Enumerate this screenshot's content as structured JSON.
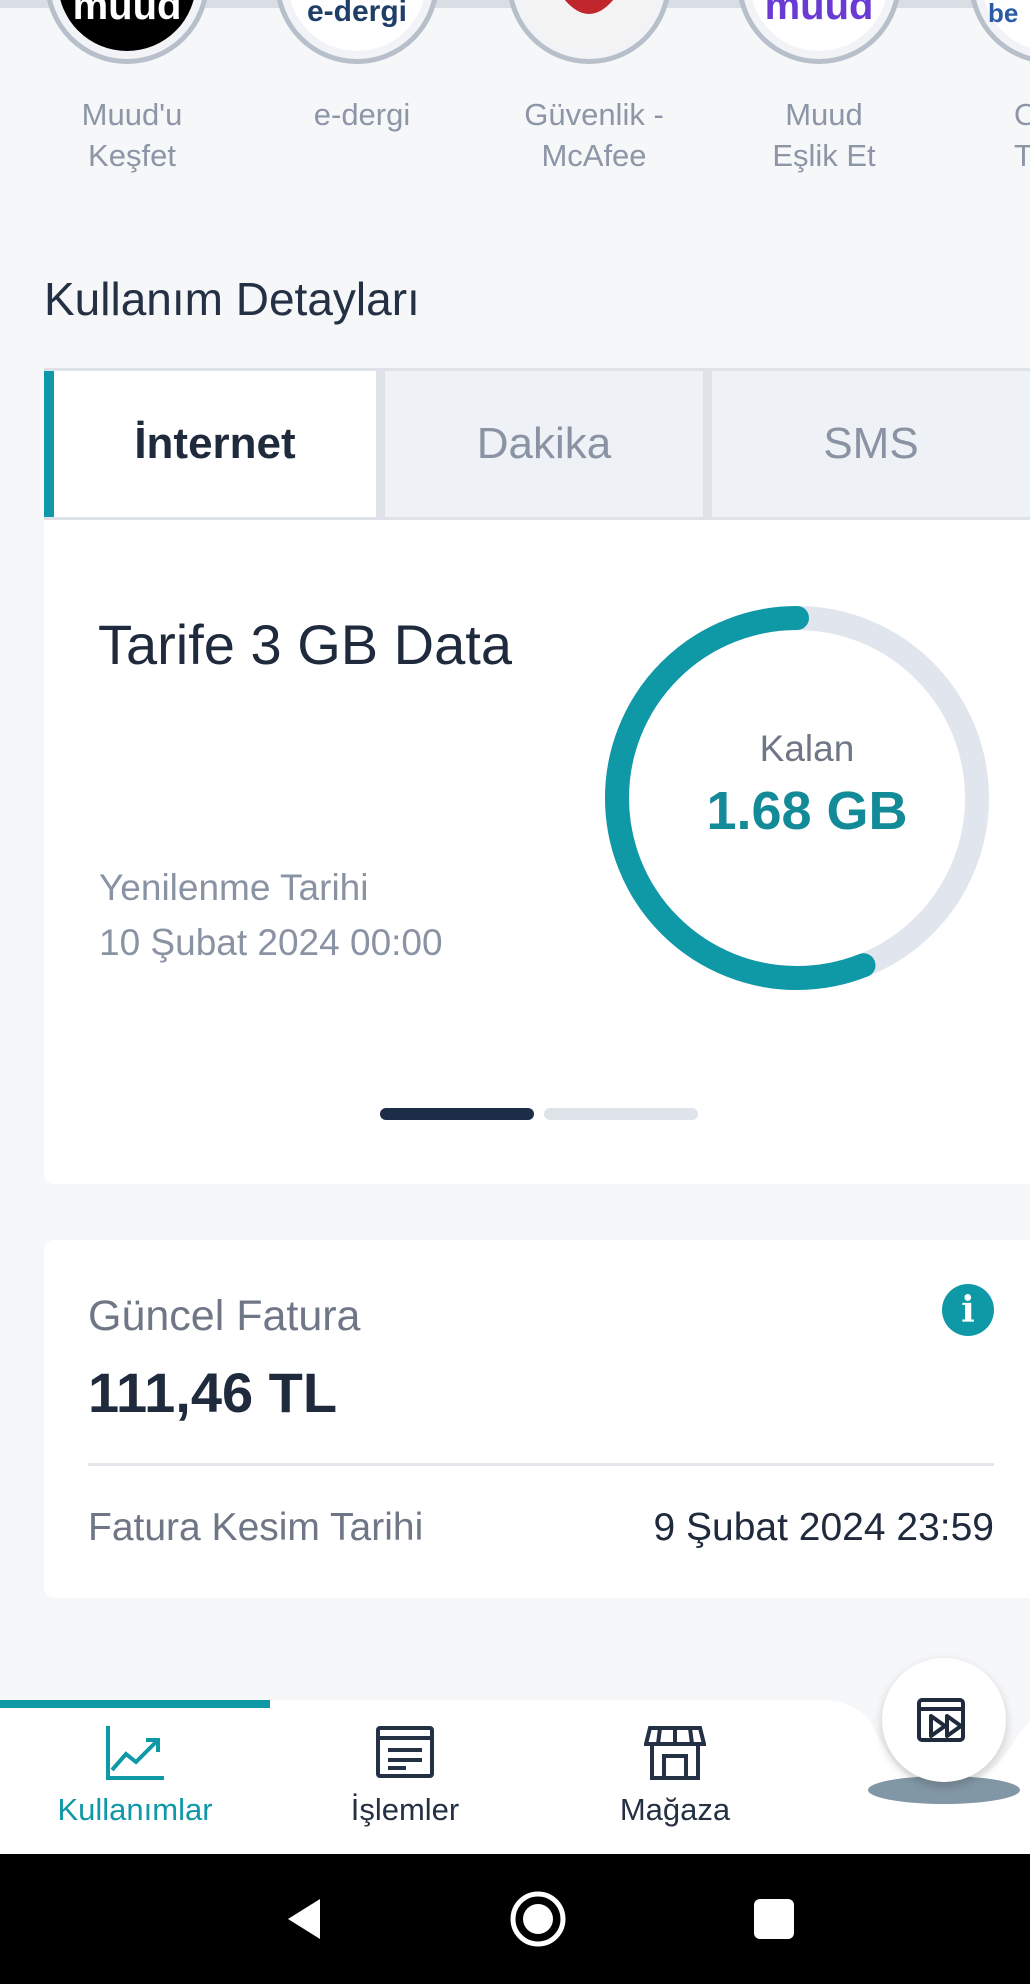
{
  "stories": [
    {
      "label": "Muud'u\nKeşfet",
      "logo_text": "muud",
      "logo_color": "#ffffff",
      "bg": "#000000"
    },
    {
      "label": "e-dergi",
      "logo_text": "e-dergi",
      "logo_color": "#1f3f66",
      "bg": "#ffffff"
    },
    {
      "label": "Güvenlik -\nMcAfee",
      "logo_text": "",
      "logo_color": "#c0272d",
      "bg": "#f3f3f3"
    },
    {
      "label": "Muud\nEşlik Et",
      "logo_text": "muud",
      "logo_color": "#6a3bd4",
      "bg": "#ffffff"
    },
    {
      "label": "O\nTe",
      "logo_text": "be",
      "logo_color": "#2b5aa6",
      "bg": "#ffffff"
    }
  ],
  "usage_section": {
    "title": "Kullanım Detayları",
    "tabs": [
      "İnternet",
      "Dakika",
      "SMS"
    ],
    "active_tab": "İnternet"
  },
  "usage_card": {
    "plan_name": "Tarife 3 GB Data",
    "renewal_label": "Yenilenme Tarihi",
    "renewal_date": "10 Şubat 2024 00:00",
    "gauge_label": "Kalan",
    "gauge_value": "1.68 GB",
    "remaining_fraction": 0.56,
    "colors": {
      "accent": "#0f98a6",
      "track": "#e1e5ee"
    },
    "pager": {
      "count": 2,
      "active": 0
    }
  },
  "bill_card": {
    "label": "Güncel Fatura",
    "amount": "111,46 TL",
    "cut_label": "Fatura Kesim Tarihi",
    "cut_date": "9 Şubat 2024 23:59",
    "info_icon": "info-icon"
  },
  "bottom_nav": {
    "items": [
      {
        "label": "Kullanımlar",
        "icon": "chart-icon",
        "active": true
      },
      {
        "label": "İşlemler",
        "icon": "document-icon",
        "active": false
      },
      {
        "label": "Mağaza",
        "icon": "store-icon",
        "active": false
      }
    ],
    "fab_icon": "play-media-icon"
  },
  "system_nav": [
    "back-icon",
    "home-icon",
    "recents-icon"
  ]
}
